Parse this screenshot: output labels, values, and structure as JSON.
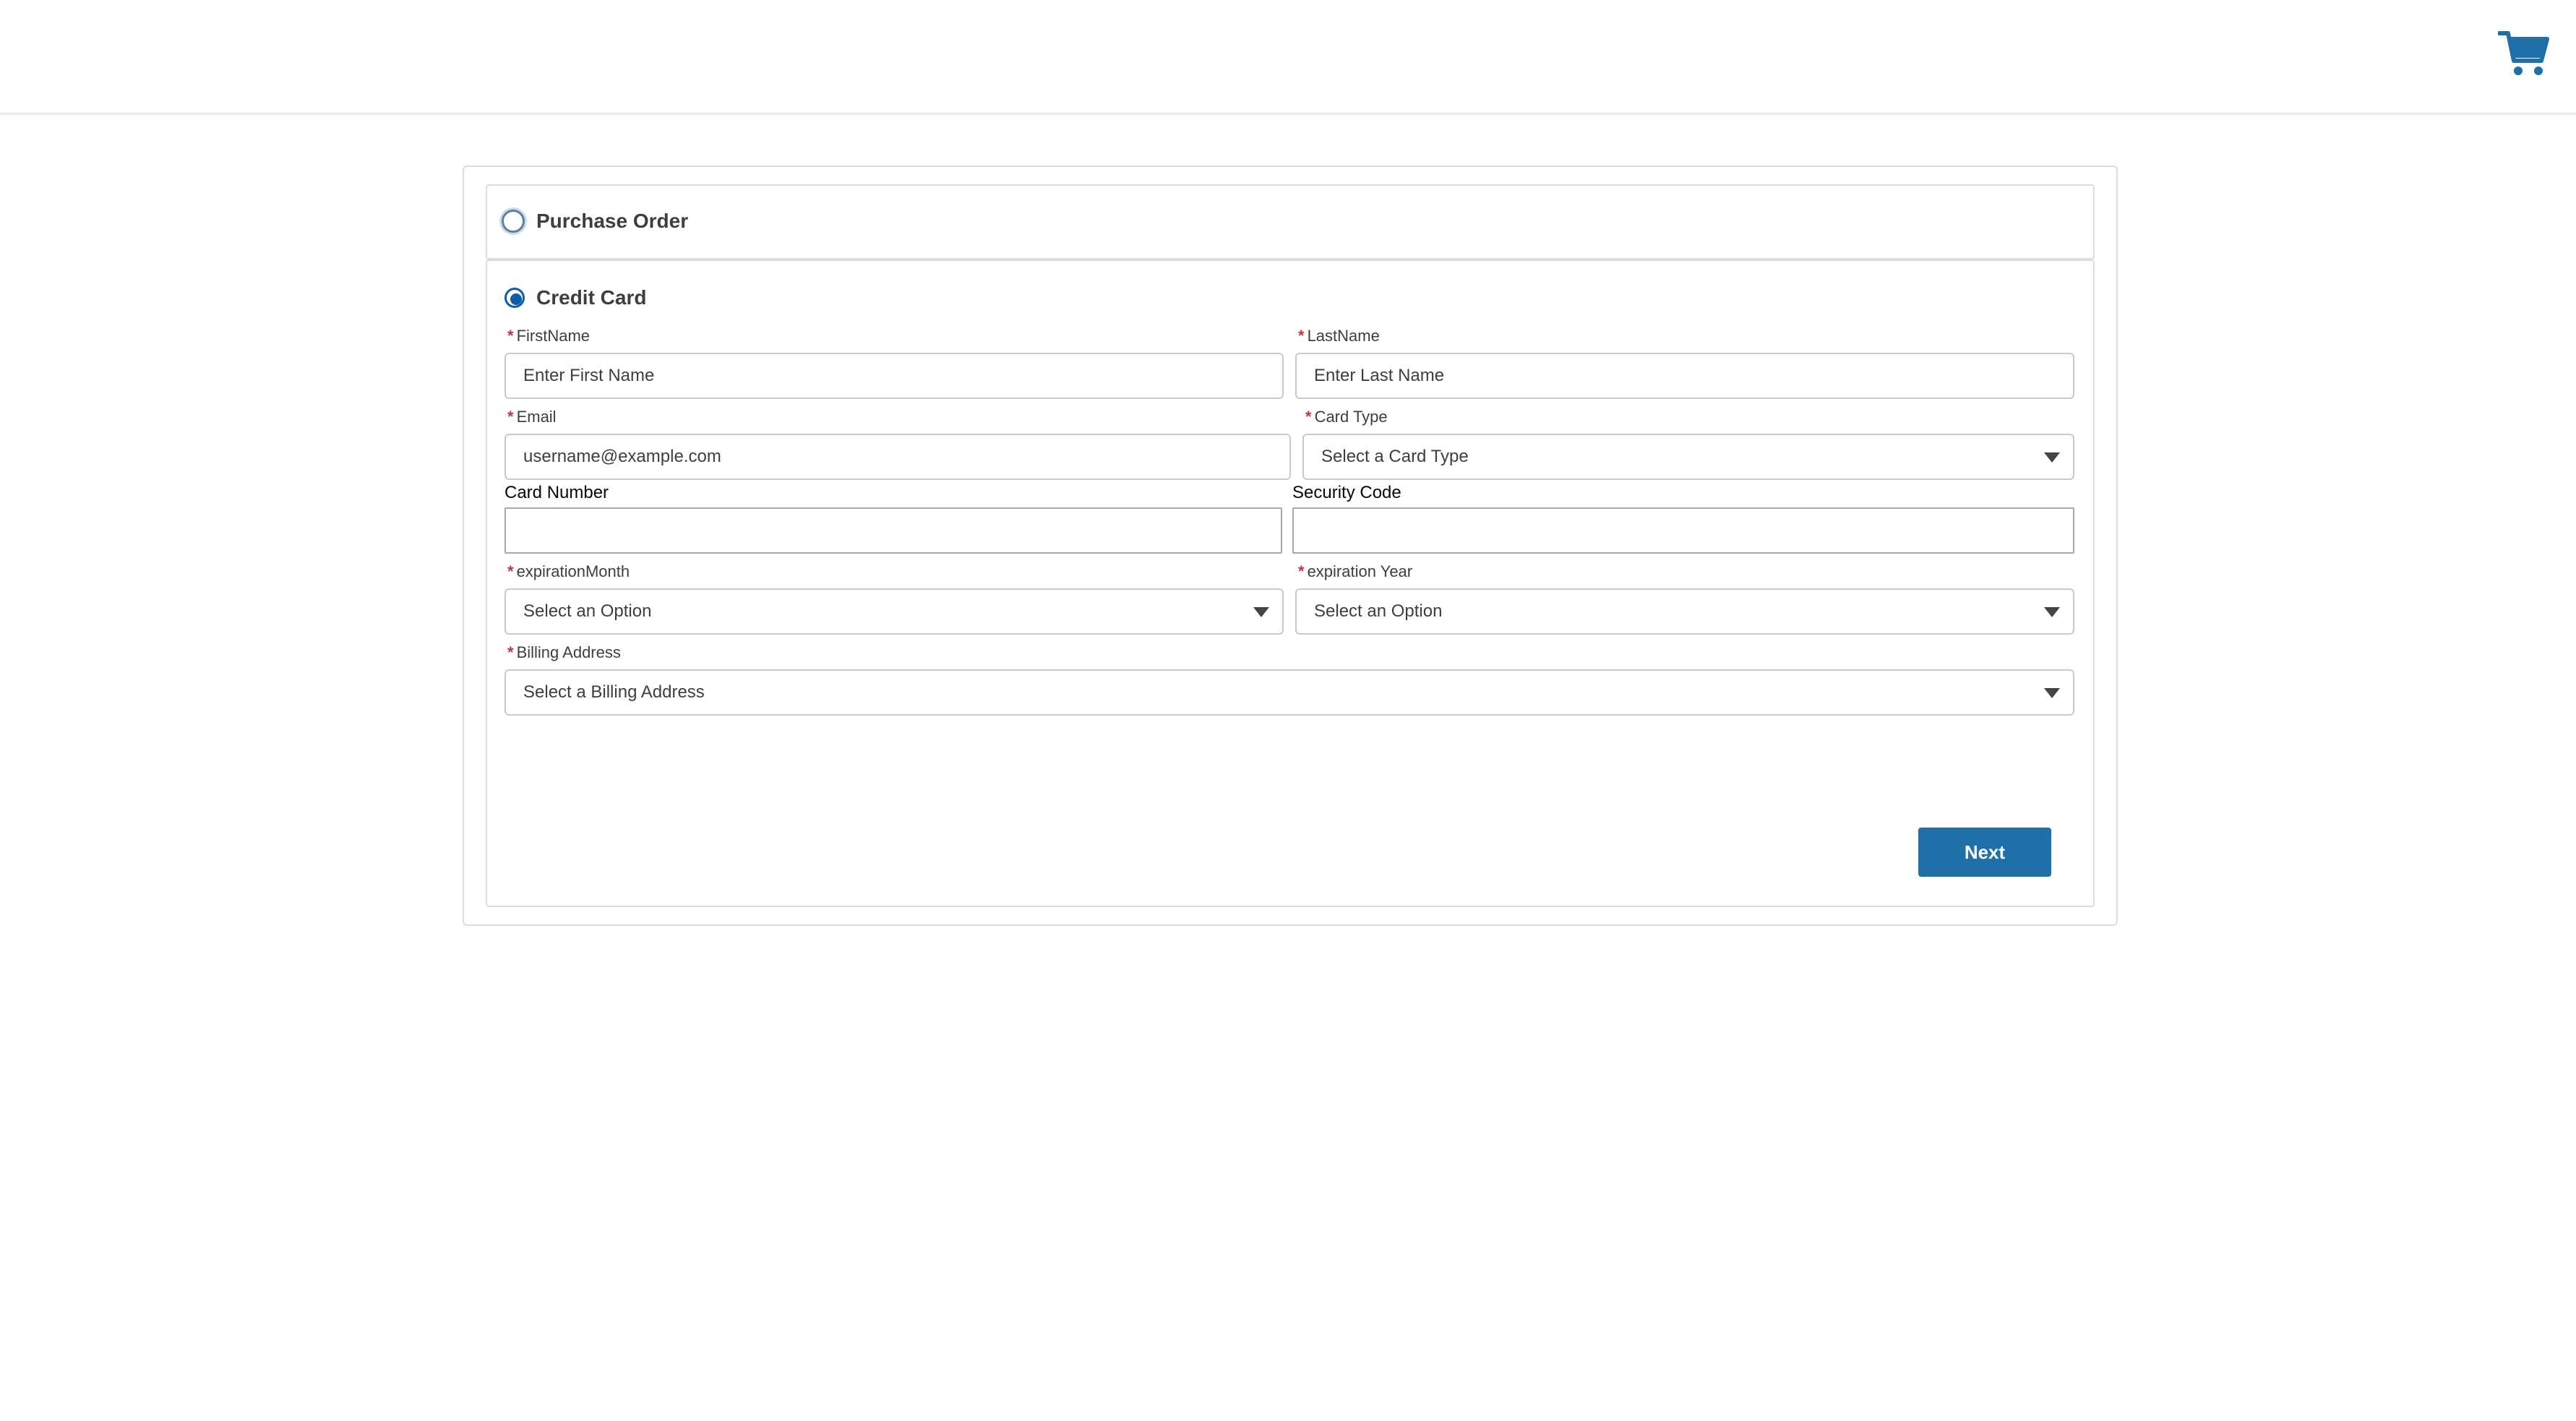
{
  "colors": {
    "accent": "#0b5cab",
    "button": "#1f6fa8",
    "cart_icon": "#1f6fa8",
    "required": "#c23934"
  },
  "header": {
    "cart_icon": "shopping-cart-icon"
  },
  "payment": {
    "purchase_order": {
      "label": "Purchase Order",
      "selected": false
    },
    "credit_card": {
      "label": "Credit Card",
      "selected": true
    }
  },
  "form": {
    "first_name": {
      "label": "FirstName",
      "placeholder": "Enter First Name",
      "required": "*"
    },
    "last_name": {
      "label": "LastName",
      "placeholder": "Enter Last Name",
      "required": "*"
    },
    "email": {
      "label": "Email",
      "placeholder": "username@example.com",
      "required": "*"
    },
    "card_type": {
      "label": "Card Type",
      "value": "Select a Card Type",
      "required": "*"
    },
    "card_number": {
      "label": "Card Number",
      "value": ""
    },
    "security_code": {
      "label": "Security Code",
      "value": ""
    },
    "expiration_month": {
      "label": "expirationMonth",
      "value": "Select an Option",
      "required": "*"
    },
    "expiration_year": {
      "label": "expiration Year",
      "value": "Select an Option",
      "required": "*"
    },
    "billing_address": {
      "label": "Billing Address",
      "value": "Select a Billing Address",
      "required": "*"
    }
  },
  "actions": {
    "next_label": "Next"
  }
}
